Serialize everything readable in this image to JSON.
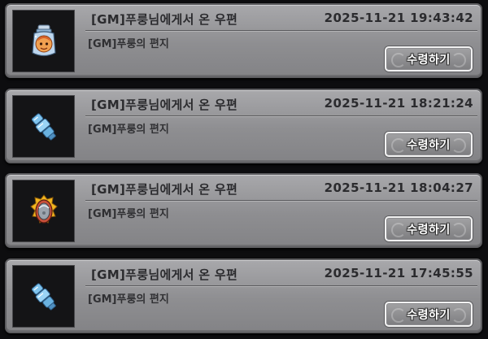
{
  "mails": [
    {
      "title": "[GM]푸룽님에게서 온 우편",
      "date": "2025-11-21 19:43:42",
      "subject": "[GM]푸룽의 편지",
      "claim_label": "수령하기",
      "icon": "potion-jar-icon"
    },
    {
      "title": "[GM]푸룽님에게서 온 우편",
      "date": "2025-11-21 18:21:24",
      "subject": "[GM]푸룽의 편지",
      "claim_label": "수령하기",
      "icon": "blue-crystal-icon"
    },
    {
      "title": "[GM]푸룽님에게서 온 우편",
      "date": "2025-11-21 18:04:27",
      "subject": "[GM]푸룽의 편지",
      "claim_label": "수령하기",
      "icon": "golden-shield-icon"
    },
    {
      "title": "[GM]푸룽님에게서 온 우편",
      "date": "2025-11-21 17:45:55",
      "subject": "[GM]푸룽의 편지",
      "claim_label": "수령하기",
      "icon": "blue-crystal-icon"
    }
  ]
}
